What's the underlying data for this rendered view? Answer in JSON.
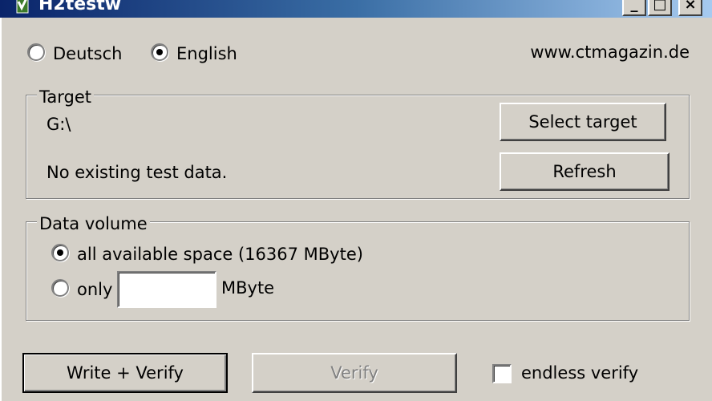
{
  "window": {
    "title": "H2testw",
    "minimize_label": "_",
    "maximize_label": "□",
    "close_label": "×"
  },
  "language": {
    "options": [
      {
        "label": "Deutsch",
        "selected": false
      },
      {
        "label": "English",
        "selected": true
      }
    ],
    "website": "www.ctmagazin.de"
  },
  "target": {
    "group_title": "Target",
    "path": "G:\\",
    "status": "No existing test data.",
    "select_button": "Select target",
    "refresh_button": "Refresh"
  },
  "data_volume": {
    "group_title": "Data volume",
    "all_label": "all available space (16367 MByte)",
    "all_selected": true,
    "only_label": "only",
    "only_selected": false,
    "only_value": "",
    "unit": "MByte"
  },
  "actions": {
    "write_verify": "Write + Verify",
    "verify": "Verify",
    "endless_verify": "endless verify",
    "endless_checked": false
  },
  "colors": {
    "face": "#d4d0c8",
    "titlebar_start": "#0a246a",
    "titlebar_end": "#a6caf0"
  }
}
